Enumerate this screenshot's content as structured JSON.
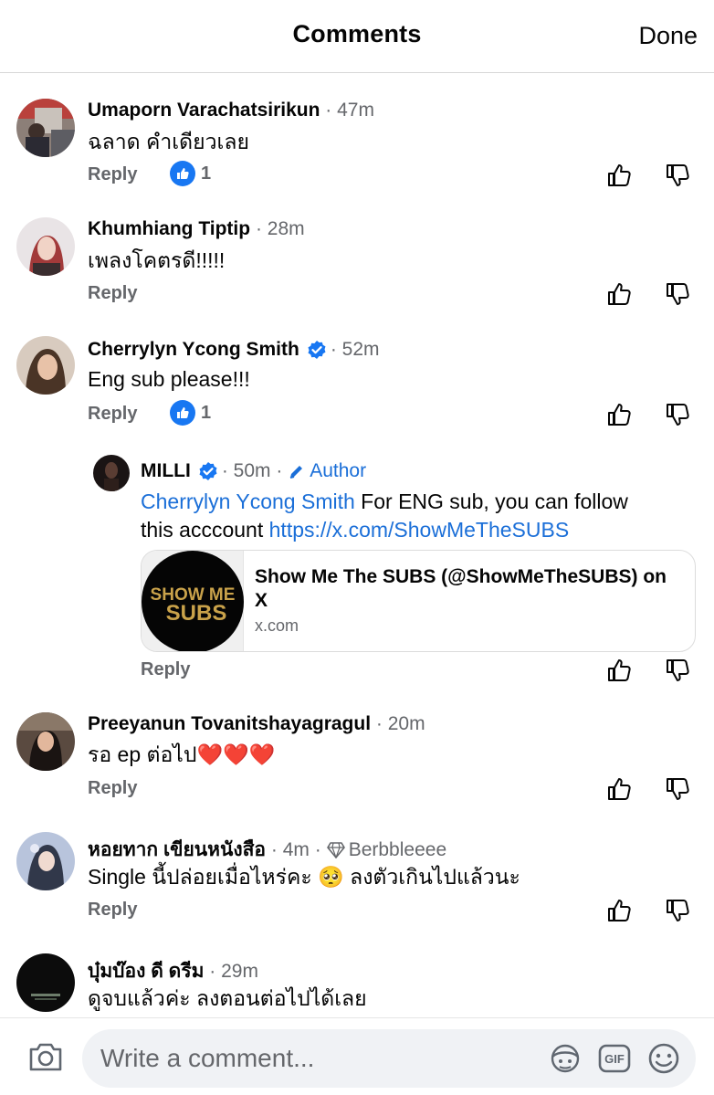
{
  "header": {
    "title": "Comments",
    "done_label": "Done"
  },
  "comments": [
    {
      "name": "Umaporn Varachatsirikun",
      "time": "· 47m",
      "text": "ฉลาด คำเดียวเลย",
      "reply_label": "Reply",
      "like_count": "1"
    },
    {
      "name": "Khumhiang Tiptip",
      "time": "· 28m",
      "text": "เพลงโคตรดี!!!!!",
      "reply_label": "Reply"
    },
    {
      "name": "Cherrylyn Ycong Smith",
      "time": "· 52m",
      "text": "Eng sub please!!!",
      "reply_label": "Reply",
      "like_count": "1"
    },
    {
      "name": "Preeyanun Tovanitshayagragul",
      "time": "· 20m",
      "text": "รอ ep ต่อไป❤️❤️❤️",
      "reply_label": "Reply"
    },
    {
      "name": "หอยทาก เขียนหนังสือ",
      "time": "· 4m ·",
      "badge": "Berbbleeee",
      "text": "Single นี้ปล่อยเมื่อไหร่คะ 🥺 ลงตัวเกินไปแล้วนะ",
      "reply_label": "Reply"
    },
    {
      "name": "บุ๋มบ๊อง ดี ดรีม",
      "time": "· 29m",
      "text": "ดูจบแล้วค่ะ ลงตอนต่อไปได้เลย"
    }
  ],
  "author_reply": {
    "name": "MILLI",
    "time": "· 50m ·",
    "author_label": "Author",
    "mention": "Cherrylyn Ycong Smith",
    "text_line1": " For ENG sub, you can follow",
    "text_line2_prefix": "this acccount ",
    "url": "https://x.com/ShowMeTheSUBS",
    "card_title": "Show Me The SUBS (@ShowMeTheSUBS) on X",
    "card_host": "x.com",
    "card_logo_line1": "SHOW ME",
    "card_logo_line2": "SUBS",
    "reply_label": "Reply"
  },
  "composer": {
    "placeholder": "Write a comment..."
  },
  "colors": {
    "accent": "#1877f2",
    "link": "#1b6fd8",
    "meta": "#65676b"
  }
}
